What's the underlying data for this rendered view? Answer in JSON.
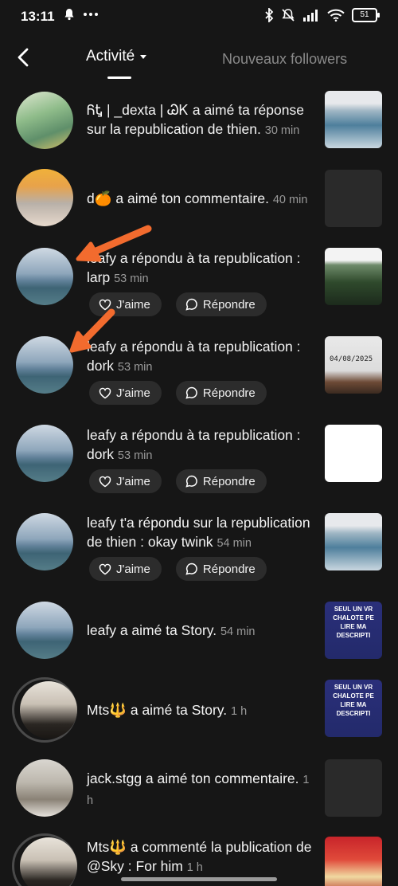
{
  "status_bar": {
    "time": "13:11",
    "battery": "51"
  },
  "header": {
    "tab_activity": "Activité",
    "tab_followers": "Nouveaux followers"
  },
  "items": [
    {
      "user": "ᏲᎿ | _dexta | ᏊᏦ",
      "action": " a aimé ta réponse sur la republication de thien.",
      "time": "30 min"
    },
    {
      "user": "d🍊",
      "action": " a aimé ton commentaire.",
      "time": "40 min"
    },
    {
      "user": "leafy",
      "action": " a répondu à ta republication : larp",
      "time": "53 min",
      "like": "J'aime",
      "reply": "Répondre"
    },
    {
      "user": "leafy",
      "action": " a répondu à ta republication : dork",
      "time": "53 min",
      "like": "J'aime",
      "reply": "Répondre",
      "thumb_text": "04/08/2025"
    },
    {
      "user": "leafy",
      "action": " a répondu à ta republication : dork",
      "time": "53 min",
      "like": "J'aime",
      "reply": "Répondre"
    },
    {
      "user": "leafy",
      "action": " t'a répondu sur la republication de thien : okay twink",
      "time": "54 min",
      "like": "J'aime",
      "reply": "Répondre"
    },
    {
      "user": "leafy",
      "action": " a aimé ta Story.",
      "time": "54 min",
      "thumb_text": "SEUL UN VR CHALOTE PE LIRE MA DESCRIPTI"
    },
    {
      "user": "Mts🔱",
      "action": " a aimé ta Story.",
      "time": "1 h",
      "thumb_text": "SEUL UN VR CHALOTE PE LIRE MA DESCRIPTI"
    },
    {
      "user": "jack.stgg",
      "action": " a aimé ton commentaire.",
      "time": "1 h"
    },
    {
      "user": "Mts🔱",
      "action": " a commenté la publication de @Sky : For him",
      "time": "1 h"
    }
  ],
  "colors": {
    "background": "#161616",
    "arrow": "#f26b2e",
    "pill": "#2c2c2c"
  }
}
